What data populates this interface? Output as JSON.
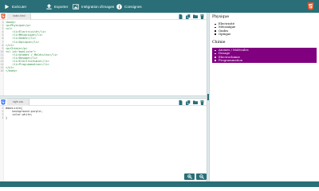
{
  "toolbar": {
    "run_label": "Exécuter",
    "export_label": "Exporter",
    "images_label": "Intégration d'images",
    "help_label": "Consignes"
  },
  "html_editor": {
    "tab_label": "index.html",
    "lines": [
      {
        "n": "1",
        "text": "<body>",
        "kind": "tag"
      },
      {
        "n": "2",
        "text": "<p>Physique</p>",
        "kind": "tag"
      },
      {
        "n": "3",
        "text": "<ul>",
        "kind": "tag"
      },
      {
        "n": "4",
        "text": "    <li>Electricité</li>",
        "kind": "tag"
      },
      {
        "n": "5",
        "text": "    <li>Mécanique</li>",
        "kind": "tag"
      },
      {
        "n": "6",
        "text": "    <li>Ondes</li>",
        "kind": "tag"
      },
      {
        "n": "7",
        "text": "    <li>Optique</li>",
        "kind": "tag"
      },
      {
        "n": "8",
        "text": "</ul>",
        "kind": "tag"
      },
      {
        "n": "9",
        "text": "<p>Chimie</p>",
        "kind": "tag"
      },
      {
        "n": "10",
        "text": "<ul id=\"monListe\">",
        "kind": "tag"
      },
      {
        "n": "11",
        "text": "    <li>Atomes / Molécules</li>",
        "kind": "tag"
      },
      {
        "n": "12",
        "text": "    <li>Dosage</li>",
        "kind": "tag"
      },
      {
        "n": "13",
        "text": "    <li>Electrochimie</li>",
        "kind": "tag"
      },
      {
        "n": "14",
        "text": "    <li>Programmation</li>",
        "kind": "tag"
      },
      {
        "n": "15",
        "text": "</ul>",
        "kind": "tag"
      },
      {
        "n": "16",
        "text": "</body>",
        "kind": "tag"
      }
    ]
  },
  "css_editor": {
    "tab_label": "style.css",
    "lines": [
      {
        "n": "1",
        "text": "#monListe{",
        "kind": "def"
      },
      {
        "n": "2",
        "text": "    background:purple;",
        "kind": "def"
      },
      {
        "n": "3",
        "text": "    color:white;",
        "kind": "def"
      },
      {
        "n": "4",
        "text": "}",
        "kind": "def"
      }
    ]
  },
  "preview": {
    "heading_1": "Physique",
    "list_1": [
      "Electricité",
      "Mécanique",
      "Ondes",
      "Optique"
    ],
    "heading_2": "Chimie",
    "list_2": [
      "Atomes / Molécules",
      "Dosage",
      "Electrochimie",
      "Programmation"
    ]
  },
  "colors": {
    "toolbar_bg": "#2a6f78",
    "list_highlight": "#800080",
    "html5_logo": "#e44d26",
    "code_tag": "#2e8b3f"
  }
}
